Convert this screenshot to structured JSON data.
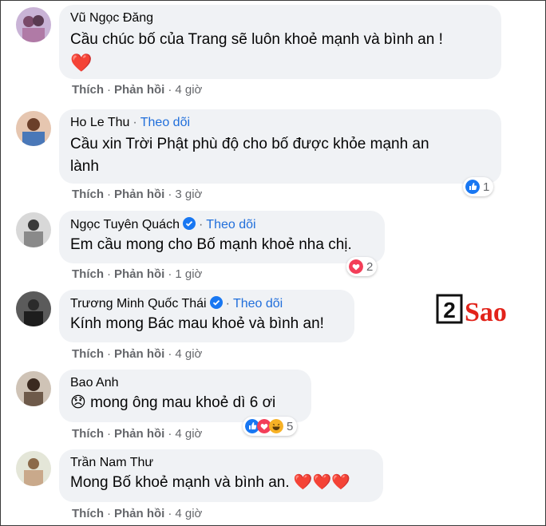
{
  "comments": [
    {
      "author": "Vũ Ngọc Đăng",
      "follow": "",
      "text": "Cầu chúc bố của Trang sẽ luôn khoẻ mạnh và bình an !",
      "text2": "",
      "like": "Thích",
      "reply": "Phản hồi",
      "time": "4 giờ",
      "reaction_count": ""
    },
    {
      "author": "Ho Le Thu",
      "follow": "Theo dõi",
      "text": "Cầu xin Trời Phật phù độ cho bố được khỏe mạnh an",
      "text2": "lành",
      "like": "Thích",
      "reply": "Phản hồi",
      "time": "3 giờ",
      "reaction_count": "1"
    },
    {
      "author": "Ngọc Tuyên Quách",
      "follow": "Theo dõi",
      "text": "Em cầu mong cho Bố mạnh khoẻ nha chị.",
      "text2": "",
      "like": "Thích",
      "reply": "Phản hồi",
      "time": "1 giờ",
      "reaction_count": "2"
    },
    {
      "author": "Trương Minh Quốc Thái",
      "follow": "Theo dõi",
      "text": "Kính mong Bác mau khoẻ và bình an!",
      "text2": "",
      "like": "Thích",
      "reply": "Phản hồi",
      "time": "4 giờ",
      "reaction_count": ""
    },
    {
      "author": "Bao Anh",
      "follow": "",
      "text": "mong ông mau khoẻ dì 6 ơi",
      "text2": "",
      "like": "Thích",
      "reply": "Phản hồi",
      "time": "4 giờ",
      "reaction_count": "5"
    },
    {
      "author": "Trần Nam Thư",
      "follow": "",
      "text": "Mong Bố khoẻ mạnh và bình an.",
      "text2": "",
      "like": "Thích",
      "reply": "Phản hồi",
      "time": "4 giờ",
      "reaction_count": ""
    }
  ],
  "watermark": {
    "digit": "2",
    "word": "Sao"
  },
  "colors": {
    "follow": "#216fdb",
    "bubble": "#f0f2f5",
    "like": "#1877f2",
    "love": "#f33e58",
    "haha": "#f7b125",
    "brand": "#e2231a"
  },
  "icons": [
    "verified-badge-icon",
    "like-reaction-icon",
    "love-reaction-icon",
    "haha-reaction-icon",
    "heart-emoji-icon",
    "sad-emoji-icon"
  ]
}
